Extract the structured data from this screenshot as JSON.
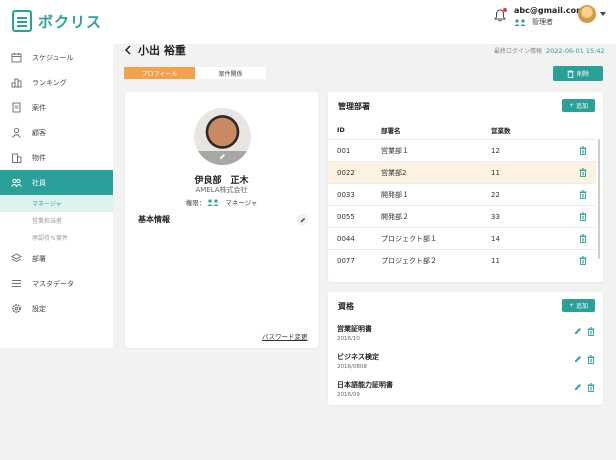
{
  "app": {
    "logo_text": "ボクリス"
  },
  "header": {
    "email": "abc@gmail.com",
    "role": "管理者",
    "accent": "#2aa198"
  },
  "sidebar": {
    "items": [
      {
        "label": "スケジュール",
        "icon": "calendar-icon"
      },
      {
        "label": "ランキング",
        "icon": "ranking-icon"
      },
      {
        "label": "案件",
        "icon": "document-icon"
      },
      {
        "label": "顧客",
        "icon": "person-icon"
      },
      {
        "label": "物件",
        "icon": "building-icon"
      },
      {
        "label": "社員",
        "icon": "people-icon"
      }
    ],
    "sub_items": [
      {
        "label": "マネージャ"
      },
      {
        "label": "営業担当者"
      },
      {
        "label": "承認待ち案件"
      }
    ],
    "items_after": [
      {
        "label": "部署",
        "icon": "layers-icon"
      },
      {
        "label": "マスタデータ",
        "icon": "list-icon"
      },
      {
        "label": "設定",
        "icon": "gear-icon"
      }
    ]
  },
  "page": {
    "title": "小出 裕重",
    "last_login_label": "最終ログイン情報",
    "last_login_value": "2022-06-01 15:42",
    "tabs": [
      "プロフィール",
      "案件関係"
    ],
    "delete_label": "削除"
  },
  "profile": {
    "name": "伊良部　正木",
    "company": "AMELA株式会社",
    "permission_label": "権限：",
    "permission_value": "マネージャ",
    "basic_info_title": "基本情報",
    "password_link": "パスワード変更"
  },
  "departments": {
    "title": "管理部署",
    "add_label": "追加",
    "columns": [
      "ID",
      "部署名",
      "営業数"
    ],
    "rows": [
      {
        "id": "001",
        "name": "営業部１",
        "count": "12"
      },
      {
        "id": "0022",
        "name": "営業部2",
        "count": "11"
      },
      {
        "id": "0033",
        "name": "開発部１",
        "count": "22"
      },
      {
        "id": "0055",
        "name": "開発部２",
        "count": "33"
      },
      {
        "id": "0044",
        "name": "プロジェクト部１",
        "count": "14"
      },
      {
        "id": "0077",
        "name": "プロジェクト部２",
        "count": "11"
      }
    ]
  },
  "qualifications": {
    "title": "資格",
    "add_label": "追加",
    "items": [
      {
        "name": "営業証明書",
        "date": "2016/10"
      },
      {
        "name": "ビジネス検定",
        "date": "2016/0808"
      },
      {
        "name": "日本語能力証明書",
        "date": "2016/09"
      }
    ]
  }
}
